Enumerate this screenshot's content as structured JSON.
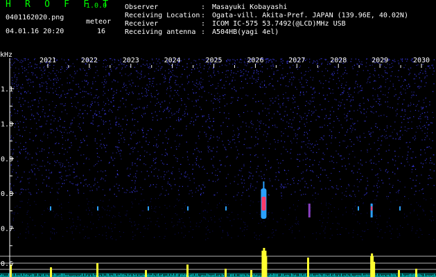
{
  "header": {
    "app_title": "H R O F F T",
    "version": "1.0.0",
    "filename": "0401162020.png",
    "datetime": "04.01.16 20:20",
    "meteor_label": "meteor",
    "meteor_count": "16",
    "fields": [
      {
        "label": "Observer",
        "value": "Masayuki Kobayashi"
      },
      {
        "label": "Receiving Location",
        "value": "Ogata-vill. Akita-Pref. JAPAN (139.96E, 40.02N)"
      },
      {
        "label": "Receiver",
        "value": "ICOM IC-575 53.7492(@LCD)MHz USB"
      },
      {
        "label": "Receiving antenna",
        "value": "A504HB(yagi 4el)"
      }
    ]
  },
  "chart_data": {
    "type": "heatmap",
    "ylabel": "kHz",
    "x_tick_labels": [
      "2021",
      "2022",
      "2023",
      "2024",
      "2025",
      "2026",
      "2027",
      "2028",
      "2029",
      "2030"
    ],
    "y_tick_labels": [
      "1.1",
      "1.0",
      "0.9",
      "0.8",
      "0.7",
      "0.6"
    ],
    "y_ticks": [
      1.1,
      1.0,
      0.9,
      0.8,
      0.7,
      0.6
    ],
    "ylim": [
      0.58,
      1.2
    ],
    "echo_x_positions": [
      2026.2,
      2028.8,
      2027.3
    ],
    "colors": {
      "background": "#000000",
      "noise": "#1a1ab4",
      "echo_strong": "#ff3a6a",
      "echo_mid": "#2aa0ff",
      "amplitude": "#ffff30",
      "baseline": "#00d7d7",
      "ref_lines": "#b4b4b4"
    }
  }
}
